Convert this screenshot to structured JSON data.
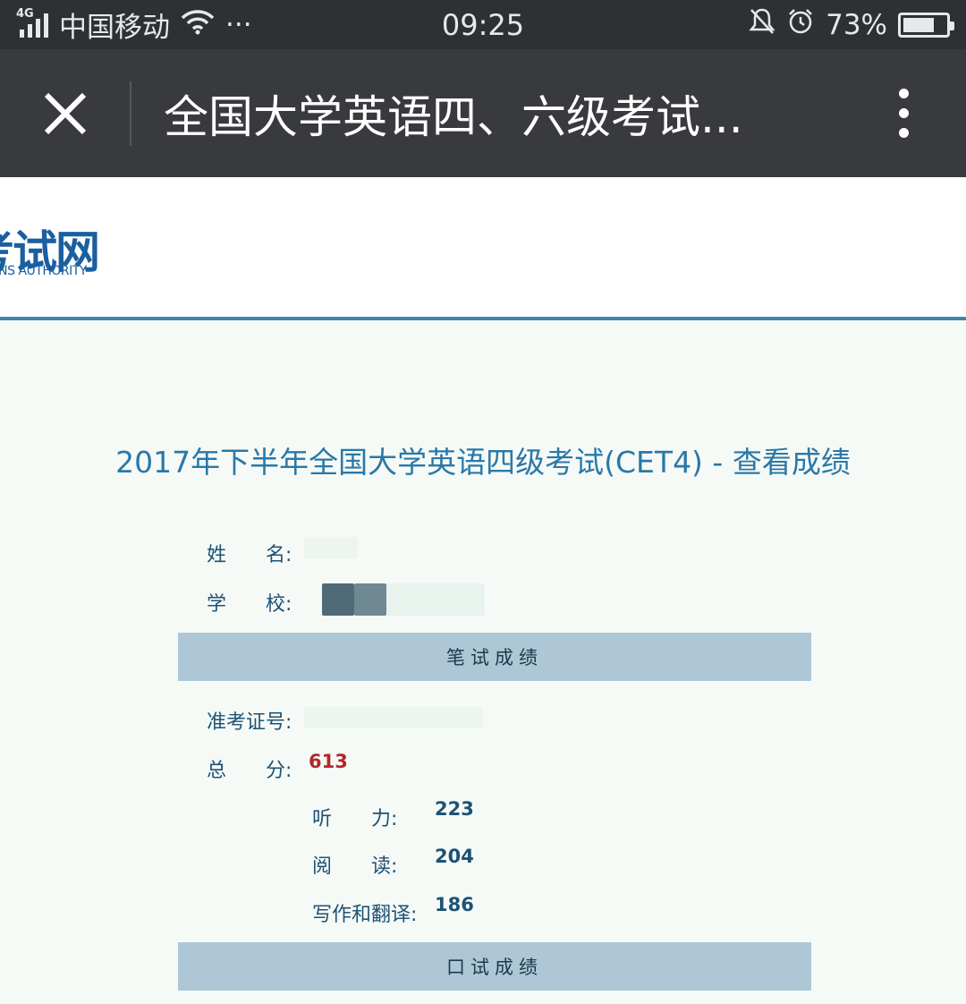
{
  "status_bar": {
    "network": "4G",
    "carrier": "中国移动",
    "more": "···",
    "time": "09:25",
    "battery_text": "73%",
    "battery_level": 0.73
  },
  "title_bar": {
    "title": "全国大学英语四、六级考试..."
  },
  "logo": {
    "cn": "考试网",
    "en": "IONS AUTHORITY"
  },
  "main_title": "2017年下半年全国大学英语四级考试(CET4) - 查看成绩",
  "info": {
    "name_label": "姓　　名:",
    "school_label": "学　　校:"
  },
  "written": {
    "header": "笔试成绩",
    "ticket_label": "准考证号:",
    "total_label": "总　　分:",
    "total_value": "613",
    "listening_label": "听　　力:",
    "listening_value": "223",
    "reading_label": "阅　　读:",
    "reading_value": "204",
    "writing_label": "写作和翻译:",
    "writing_value": "186"
  },
  "oral": {
    "header": "口试成绩"
  }
}
